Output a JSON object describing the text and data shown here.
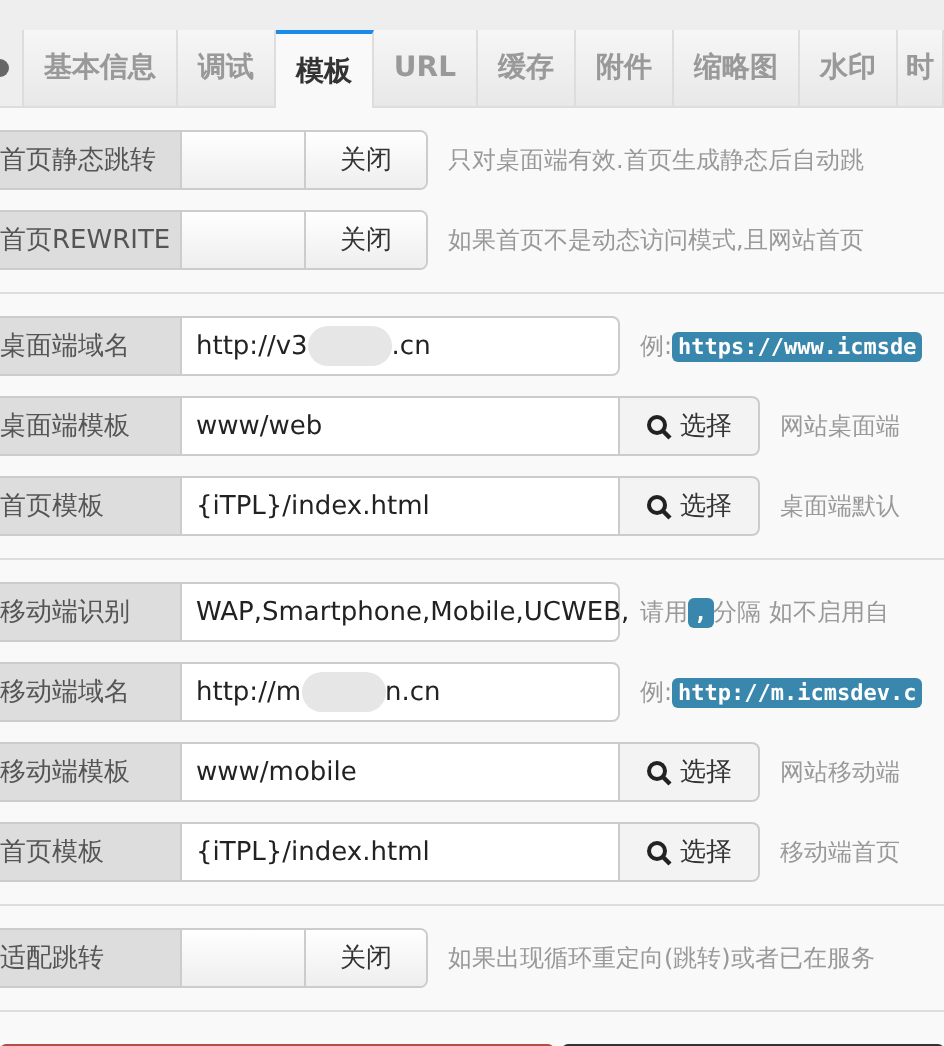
{
  "tabs": [
    {
      "label": "基本信息",
      "selected": false
    },
    {
      "label": "调试",
      "selected": false
    },
    {
      "label": "模板",
      "selected": true
    },
    {
      "label": "URL",
      "selected": false
    },
    {
      "label": "缓存",
      "selected": false
    },
    {
      "label": "附件",
      "selected": false
    },
    {
      "label": "缩略图",
      "selected": false
    },
    {
      "label": "水印",
      "selected": false
    },
    {
      "label": "时",
      "selected": false
    }
  ],
  "sections": [
    {
      "rows": [
        {
          "kind": "switch",
          "label": "首页静态跳转",
          "on": false,
          "state_text": "关闭",
          "hint": [
            {
              "kind": "text",
              "text": "只对桌面端有效.首页生成静态后自动跳"
            }
          ]
        },
        {
          "kind": "switch",
          "label": "首页REWRITE",
          "on": false,
          "state_text": "关闭",
          "hint": [
            {
              "kind": "text",
              "text": "如果首页不是动态访问模式,且网站首页"
            }
          ]
        }
      ]
    },
    {
      "rows": [
        {
          "kind": "input",
          "label": "桌面端域名",
          "value": [
            {
              "kind": "text",
              "text": "http://v3"
            },
            {
              "kind": "redacted"
            },
            {
              "kind": "text",
              "text": ".cn"
            }
          ],
          "hint": [
            {
              "kind": "text",
              "text": "例:"
            },
            {
              "kind": "code",
              "text": "https://www.icmsde"
            }
          ]
        },
        {
          "kind": "select",
          "label": "桌面端模板",
          "value": [
            {
              "kind": "text",
              "text": "www/web"
            }
          ],
          "button": "选择",
          "hint": [
            {
              "kind": "text",
              "text": "网站桌面端"
            }
          ]
        },
        {
          "kind": "select",
          "label": "首页模板",
          "value": [
            {
              "kind": "text",
              "text": "{iTPL}/index.html"
            }
          ],
          "button": "选择",
          "hint": [
            {
              "kind": "text",
              "text": "桌面端默认"
            }
          ]
        }
      ]
    },
    {
      "rows": [
        {
          "kind": "input",
          "label": "移动端识别",
          "value": [
            {
              "kind": "text",
              "text": "WAP,Smartphone,Mobile,UCWEB,"
            }
          ],
          "hint": [
            {
              "kind": "text",
              "text": "请用"
            },
            {
              "kind": "code",
              "text": ","
            },
            {
              "kind": "text",
              "text": "分隔 如不启用自"
            }
          ]
        },
        {
          "kind": "input",
          "label": "移动端域名",
          "value": [
            {
              "kind": "text",
              "text": "http://m"
            },
            {
              "kind": "redacted"
            },
            {
              "kind": "text",
              "text": "n.cn"
            }
          ],
          "hint": [
            {
              "kind": "text",
              "text": "例:"
            },
            {
              "kind": "code",
              "text": "http://m.icmsdev.c"
            }
          ]
        },
        {
          "kind": "select",
          "label": "移动端模板",
          "value": [
            {
              "kind": "text",
              "text": "www/mobile"
            }
          ],
          "button": "选择",
          "hint": [
            {
              "kind": "text",
              "text": "网站移动端"
            }
          ]
        },
        {
          "kind": "select",
          "label": "首页模板",
          "value": [
            {
              "kind": "text",
              "text": "{iTPL}/index.html"
            }
          ],
          "button": "选择",
          "hint": [
            {
              "kind": "text",
              "text": "移动端首页"
            }
          ]
        }
      ]
    },
    {
      "rows": [
        {
          "kind": "switch",
          "label": "适配跳转",
          "on": false,
          "state_text": "关闭",
          "hint": [
            {
              "kind": "text",
              "text": "如果出现循环重定向(跳转)或者已在服务"
            }
          ]
        }
      ]
    }
  ]
}
